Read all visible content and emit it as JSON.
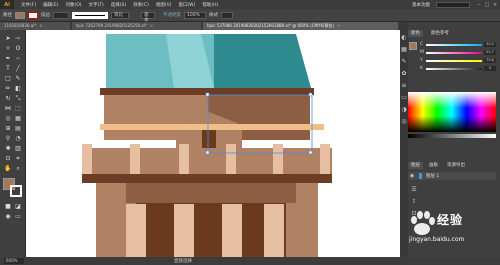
{
  "app": {
    "logo": "Ai"
  },
  "menubar": {
    "items": [
      "文件(F)",
      "编辑(E)",
      "对象(O)",
      "文字(T)",
      "选择(S)",
      "效果(C)",
      "视图(V)",
      "窗口(W)",
      "帮助(H)"
    ],
    "workspace": "基本功能"
  },
  "controlbar": {
    "label": "路径",
    "fill_color": "#a0785a",
    "stroke_label": "描边",
    "stroke_profile": "等比",
    "brush_label": "基本",
    "opacity_label": "不透明度",
    "opacity_value": "100%",
    "style_label": "样式"
  },
  "tabs": [
    {
      "label": "1161816830.ai*",
      "active": false
    },
    {
      "label": "hpic 7262799 20190820125259.ai*",
      "active": false
    },
    {
      "label": "hpic 537086 20190820202152601889.ai* @ 600% (CMYK/预览)",
      "active": true
    }
  ],
  "status": {
    "zoom": "600%",
    "selection": "直接选择"
  },
  "panels": {
    "color_tab": "颜色",
    "color_guide_tab": "颜色参考",
    "channels": [
      {
        "label": "C",
        "value": "30.2",
        "color": "#00aeef"
      },
      {
        "label": "M",
        "value": "55.7",
        "color": "#ec008c"
      },
      {
        "label": "Y",
        "value": "79.6",
        "color": "#fff200"
      },
      {
        "label": "K",
        "value": "0",
        "color": "#222222"
      }
    ],
    "layers_tabs": [
      "图层",
      "画板",
      "资源导出"
    ],
    "layer_name": "图层 1"
  },
  "watermark": {
    "text": "经验",
    "brand": "Bai",
    "url": "jingyan.baidu.com"
  },
  "colors": {
    "roof_light": "#8fd3d6",
    "roof_mid": "#6cbec3",
    "roof_dark": "#2f8a8f",
    "wall": "#b08163",
    "wall_dark": "#8d5e44",
    "trim": "#f1be87",
    "cornice": "#6b3d24",
    "column": "#e6bfa2",
    "door": "#6b3a1d"
  }
}
